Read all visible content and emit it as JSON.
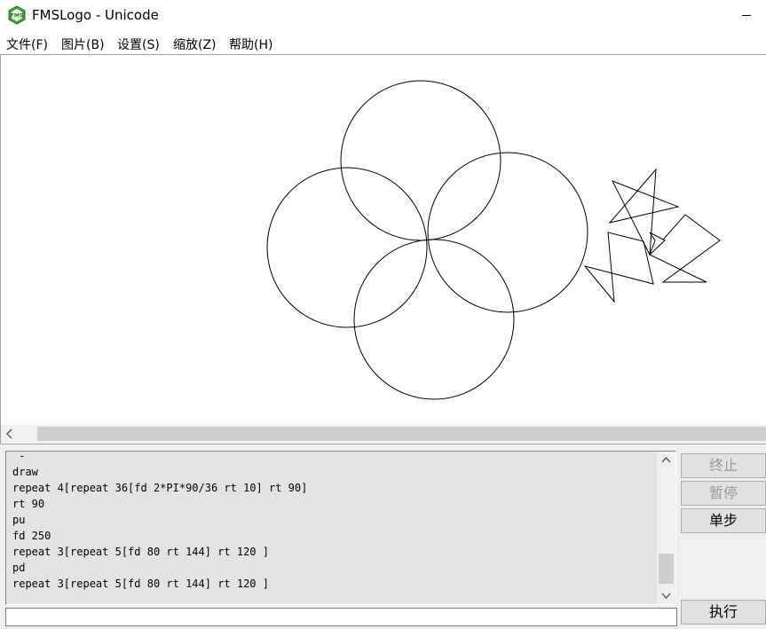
{
  "window": {
    "title": "FMSLogo - Unicode",
    "icon": "fmslogo-icon"
  },
  "menu": {
    "items": [
      {
        "label": "文件(F)"
      },
      {
        "label": "图片(B)"
      },
      {
        "label": "设置(S)"
      },
      {
        "label": "缩放(Z)"
      },
      {
        "label": "帮助(H)"
      }
    ]
  },
  "history": {
    "lines": [
      " -",
      "draw",
      "repeat 4[repeat 36[fd 2*PI*90/36 rt 10] rt 90]",
      "rt 90",
      "pu",
      "fd 250",
      "repeat 3[repeat 5[fd 80 rt 144] rt 120 ]",
      "pd",
      "repeat 3[repeat 5[fd 80 rt 144] rt 120 ]"
    ]
  },
  "buttons": {
    "halt": "终止",
    "pause": "暂停",
    "step": "单步",
    "execute": "执行"
  },
  "input": {
    "value": ""
  },
  "icons": {
    "minimize": "minimize-icon",
    "scroll_left": "arrow-left-icon",
    "scroll_up": "arrow-up-icon",
    "scroll_down": "arrow-down-icon"
  },
  "colors": {
    "drawing_stroke": "#000000",
    "canvas_background": "#ffffff",
    "panel_background": "#f0f0f0",
    "history_background": "#e3e3e3",
    "disabled_text": "#9a9a9a"
  }
}
